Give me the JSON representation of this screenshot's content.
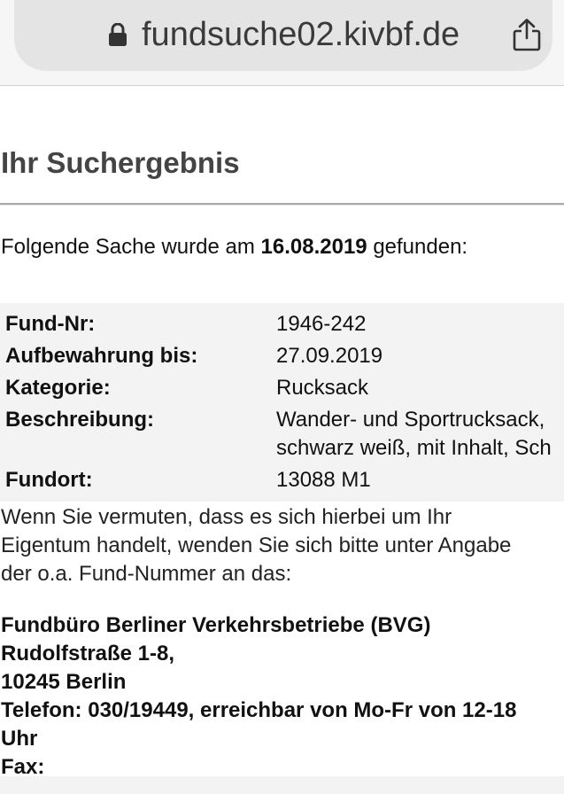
{
  "browser": {
    "url": "fundsuche02.kivbf.de",
    "lock_icon": "lock-icon",
    "share_icon": "share-icon"
  },
  "page": {
    "title": "Ihr Suchergebnis",
    "found_prefix": "Folgende Sache wurde am",
    "found_date": "16.08.2019",
    "found_suffix": "gefunden:"
  },
  "details": [
    {
      "label": "Fund-Nr:",
      "value": "1946-242"
    },
    {
      "label": "Aufbewahrung bis:",
      "value": "27.09.2019"
    },
    {
      "label": "Kategorie:",
      "value": "Rucksack"
    },
    {
      "label": "Beschreibung:",
      "value": "Wander- und Sportrucksack,",
      "value_line2": "schwarz weiß, mit Inhalt, Sch"
    },
    {
      "label": "Fundort:",
      "value": "13088 M1"
    }
  ],
  "info": {
    "line1": "Wenn Sie vermuten, dass es sich hierbei um Ihr",
    "line2": "Eigentum handelt, wenden Sie sich bitte unter Angabe",
    "line3": "der o.a. Fund-Nummer an das:"
  },
  "office": {
    "name": "Fundbüro Berliner Verkehrsbetriebe (BVG)",
    "street": "Rudolfstraße 1-8,",
    "city": "10245 Berlin",
    "phone": "Telefon: 030/19449, erreichbar von Mo-Fr von 12-18",
    "phone_cont": "Uhr",
    "fax": "Fax:"
  }
}
